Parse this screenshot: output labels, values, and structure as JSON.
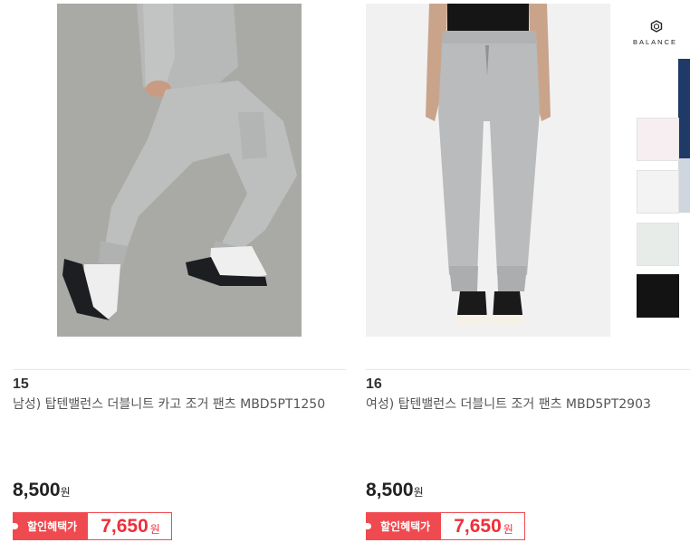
{
  "products": [
    {
      "rank": "15",
      "title": "남성) 탑텐밸런스 더블니트 카고 조거 팬츠 MBD5PT1250",
      "price": "8,500",
      "price_unit": "원",
      "sale_label": "할인혜택가",
      "sale_price": "7,650",
      "sale_unit": "원"
    },
    {
      "rank": "16",
      "title": "여성) 탑텐밸런스 더블니트 조거 팬츠 MBD5PT2903",
      "price": "8,500",
      "price_unit": "원",
      "sale_label": "할인혜택가",
      "sale_price": "7,650",
      "sale_unit": "원"
    }
  ],
  "partial_card": {
    "brand_text": "BALANCE",
    "swatch_colors": [
      "#f6eef0",
      "#f3f3f3",
      "#e7ece8",
      "#131313"
    ]
  },
  "colors": {
    "sale_accent": "#ef4a4f",
    "sale_price_text": "#ef2f3a"
  }
}
